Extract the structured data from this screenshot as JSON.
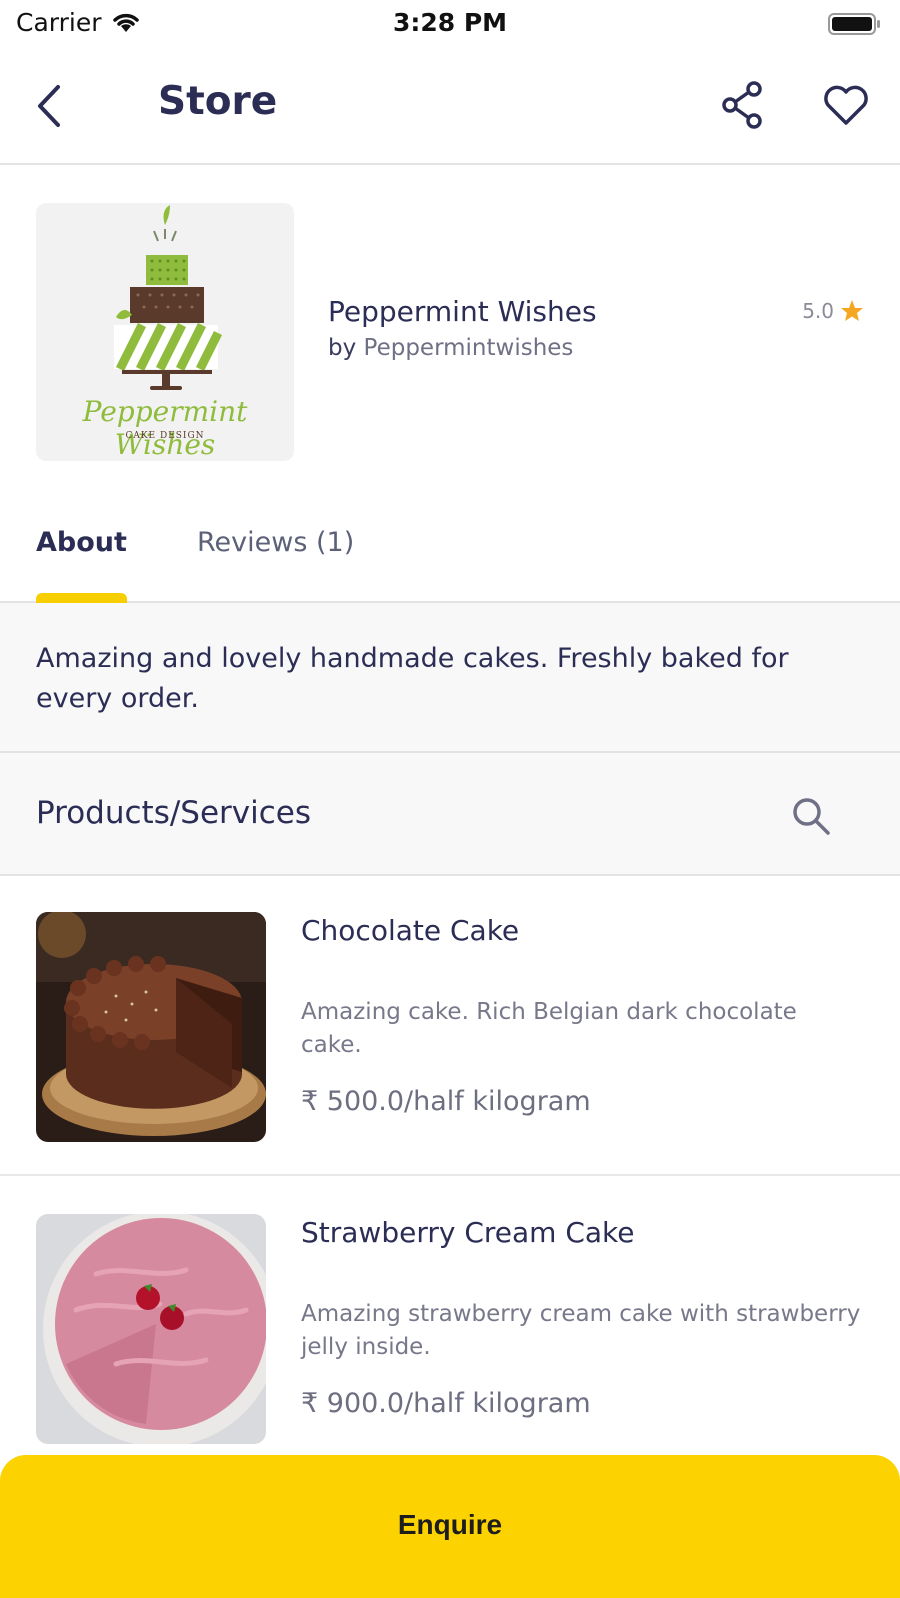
{
  "status_bar": {
    "carrier": "Carrier",
    "time": "3:28 PM"
  },
  "nav": {
    "title": "Store"
  },
  "store": {
    "name": "Peppermint Wishes",
    "by_label": "by",
    "owner": "Peppermintwishes",
    "rating": "5.0",
    "logo_text": "Peppermint Wishes",
    "logo_subtext": "CAKE DESIGN"
  },
  "tabs": [
    {
      "label": "About",
      "active": true
    },
    {
      "label": "Reviews (1)",
      "active": false
    }
  ],
  "about": {
    "text": "Amazing and lovely handmade cakes. Freshly baked for every order."
  },
  "products": {
    "title": "Products/Services",
    "items": [
      {
        "name": "Chocolate Cake",
        "description": "Amazing cake. Rich Belgian dark chocolate cake.",
        "price": "₹ 500.0/half kilogram"
      },
      {
        "name": "Strawberry Cream Cake",
        "description": "Amazing strawberry cream cake with strawberry jelly inside.",
        "price": "₹ 900.0/half kilogram"
      }
    ]
  },
  "footer": {
    "enquire_label": "Enquire"
  },
  "colors": {
    "accent": "#fcd200",
    "text_primary": "#2b2d55",
    "star": "#f5a623"
  }
}
